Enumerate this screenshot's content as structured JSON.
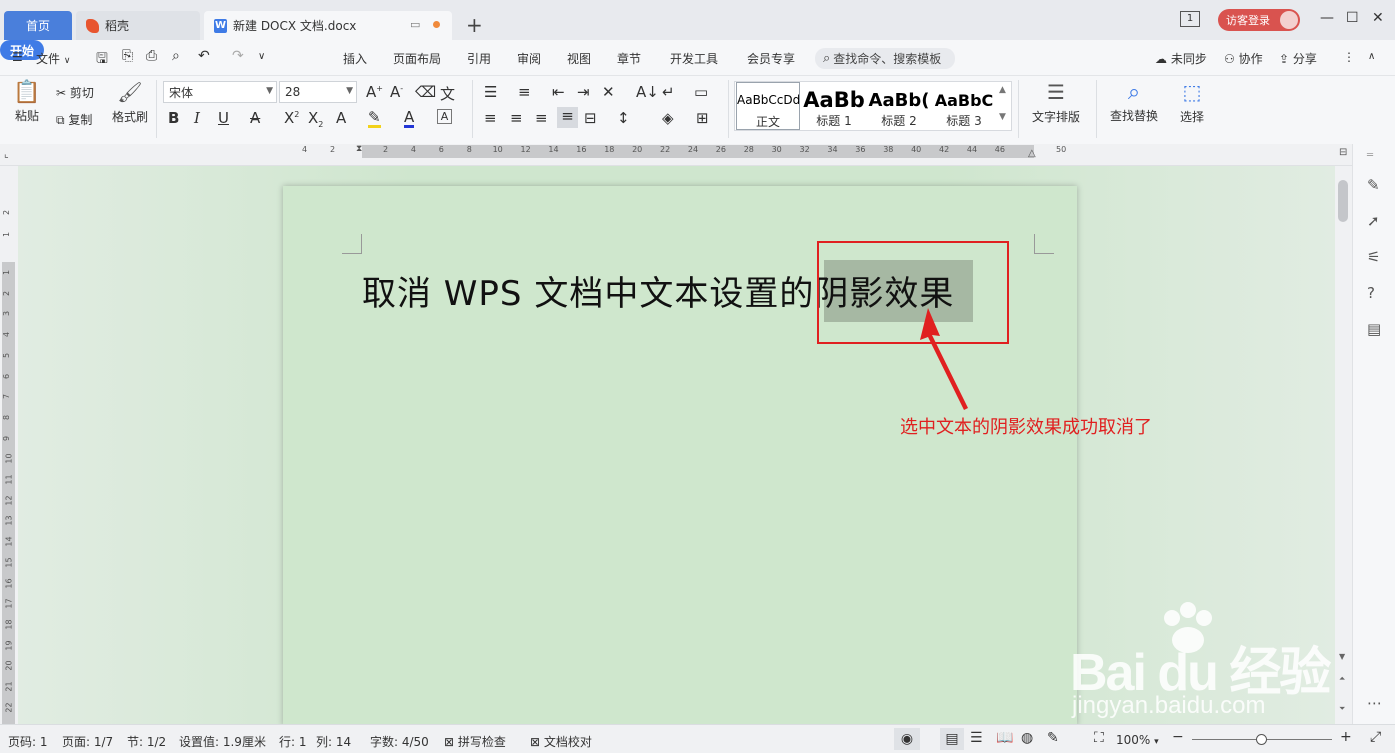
{
  "titlebar": {
    "tab_home": "首页",
    "tab_daoke": "稻壳",
    "tab_doc": "新建 DOCX 文档.docx",
    "visitor_login": "访客登录",
    "page_indicator": "1"
  },
  "menubar": {
    "file": "文件",
    "items": [
      "开始",
      "插入",
      "页面布局",
      "引用",
      "审阅",
      "视图",
      "章节",
      "开发工具",
      "会员专享"
    ],
    "search_placeholder": "查找命令、搜索模板",
    "right": [
      "未同步",
      "协作",
      "分享"
    ]
  },
  "ribbon": {
    "paste": "粘贴",
    "cut": "剪切",
    "copy": "复制",
    "format_painter": "格式刷",
    "font_name": "宋体",
    "font_size": "28",
    "styles": [
      {
        "preview": "AaBbCcDd",
        "name": "正文"
      },
      {
        "preview": "AaBb",
        "name": "标题 1"
      },
      {
        "preview": "AaBb(",
        "name": "标题 2"
      },
      {
        "preview": "AaBbC",
        "name": "标题 3"
      }
    ],
    "text_layout": "文字排版",
    "find_replace": "查找替换",
    "select": "选择"
  },
  "ruler": {
    "h_left": [
      "4",
      "2"
    ],
    "h_right": [
      "2",
      "4",
      "6",
      "8",
      "10",
      "12",
      "14",
      "16",
      "18",
      "20",
      "22",
      "24",
      "26",
      "28",
      "30",
      "32",
      "34",
      "36",
      "38",
      "40",
      "42",
      "44",
      "46"
    ],
    "h_end": "50",
    "v_top": [
      "2",
      "1"
    ],
    "v_main": [
      "1",
      "2",
      "3",
      "4",
      "5",
      "6",
      "7",
      "8",
      "9",
      "10",
      "11",
      "12",
      "13",
      "14",
      "15",
      "16",
      "17",
      "18",
      "19",
      "20",
      "21",
      "22"
    ]
  },
  "document": {
    "line_plain": "取消 WPS 文档中文本设置的",
    "line_selected": "阴影效果",
    "annotation": "选中文本的阴影效果成功取消了"
  },
  "status": {
    "page_code": "页码: 1",
    "page": "页面: 1/7",
    "section": "节: 1/2",
    "setting": "设置值: 1.9厘米",
    "row": "行: 1",
    "col": "列: 14",
    "words": "字数: 4/50",
    "spell": "拼写检查",
    "proof": "文档校对",
    "zoom": "100%"
  },
  "watermark": {
    "brand": "Bai du 经验",
    "url": "jingyan.baidu.com"
  },
  "colors": {
    "accent": "#3f7be6",
    "annotation_red": "#e02020",
    "page_bg": "#cfe7cd"
  }
}
